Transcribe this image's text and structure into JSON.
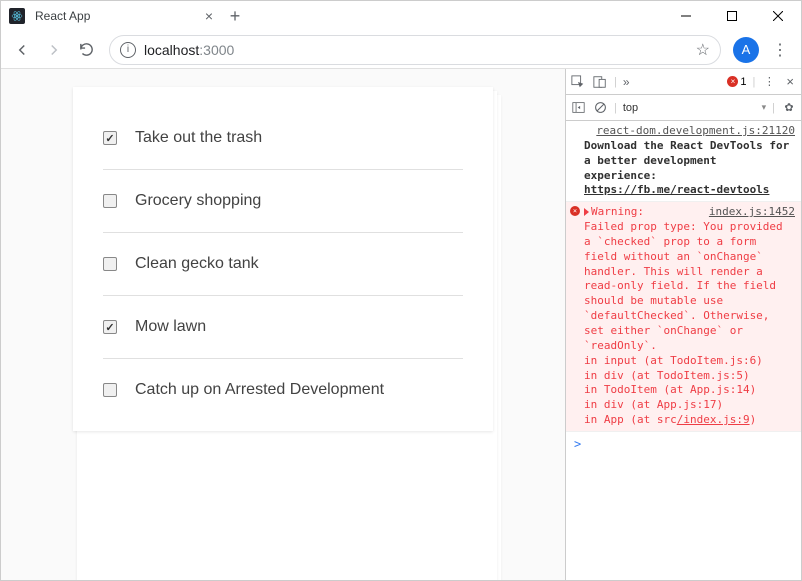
{
  "window": {
    "tab_title": "React App",
    "controls": {
      "min": "minimize",
      "max": "maximize",
      "close": "close"
    }
  },
  "toolbar": {
    "url_host": "localhost",
    "url_port": ":3000",
    "avatar_letter": "A"
  },
  "todos": [
    {
      "label": "Take out the trash",
      "checked": true
    },
    {
      "label": "Grocery shopping",
      "checked": false
    },
    {
      "label": "Clean gecko tank",
      "checked": false
    },
    {
      "label": "Mow lawn",
      "checked": true
    },
    {
      "label": "Catch up on Arrested Development",
      "checked": false
    }
  ],
  "devtools": {
    "error_count": "1",
    "context": "top",
    "log1_source": "react-dom.development.js:21120",
    "log1_text": "Download the React DevTools for a better development experience: ",
    "log1_link": "https://fb.me/react-devtools",
    "warn_label": "Warning:",
    "warn_source": "index.js:1452",
    "warn_body": "Failed prop type: You provided a `checked` prop to a form field without an `onChange` handler. This will render a read-only field. If the field should be mutable use `defaultChecked`. Otherwise, set either `onChange` or `readOnly`.",
    "stack": [
      "    in input (at TodoItem.js:6)",
      "    in div (at TodoItem.js:5)",
      "    in TodoItem (at App.js:14)",
      "    in div (at App.js:17)",
      "    in App (at src/index.js:9)"
    ],
    "stack_last_prefix": "    in App (at src",
    "stack_last_link": "/index.js:9",
    "stack_last_suffix": ")",
    "prompt": ">"
  }
}
